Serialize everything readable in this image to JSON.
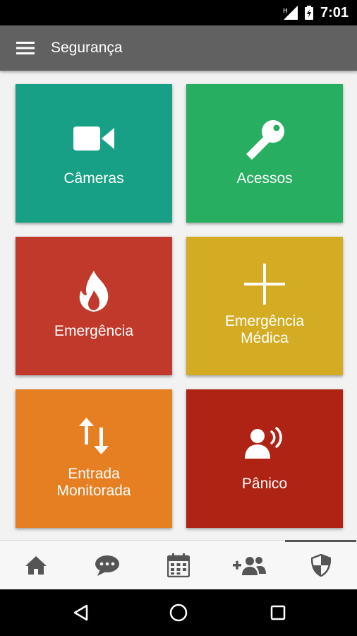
{
  "status_bar": {
    "time": "7:01"
  },
  "app_bar": {
    "title": "Segurança"
  },
  "tiles": [
    {
      "label": "Câmeras",
      "icon": "video-camera-icon",
      "color": "#17A085"
    },
    {
      "label": "Acessos",
      "icon": "key-icon",
      "color": "#27AE60"
    },
    {
      "label": "Emergência",
      "icon": "fire-icon",
      "color": "#C0392B"
    },
    {
      "label": "Emergência\nMédica",
      "icon": "plus-icon",
      "color": "#D4AC23"
    },
    {
      "label": "Entrada\nMonitorada",
      "icon": "up-down-arrows-icon",
      "color": "#E67E22"
    },
    {
      "label": "Pânico",
      "icon": "panic-alarm-icon",
      "color": "#AE2313"
    }
  ],
  "bottom_nav": {
    "items": [
      {
        "icon": "home-icon"
      },
      {
        "icon": "chat-icon"
      },
      {
        "icon": "calendar-icon"
      },
      {
        "icon": "add-people-icon"
      },
      {
        "icon": "shield-icon",
        "active": true
      }
    ]
  },
  "system_nav": {
    "items": [
      "back-icon",
      "home-circle-icon",
      "recents-icon"
    ]
  },
  "colors": {
    "status_bar": "#000000",
    "app_bar": "#616161",
    "background": "#F2F2F2",
    "nav_icon": "#555555"
  }
}
